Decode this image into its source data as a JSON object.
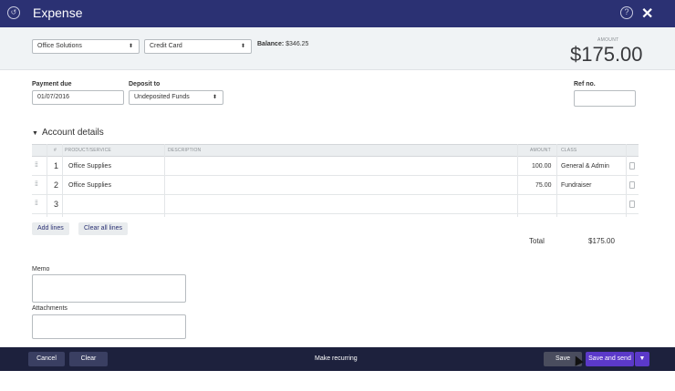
{
  "window": {
    "title": "Expense",
    "help_icon": "question-icon",
    "close_icon": "close-icon"
  },
  "header": {
    "payee": "Office Solutions",
    "account": "Credit Card",
    "balance_label": "Balance:",
    "balance_value": "$346.25",
    "amount_label": "AMOUNT",
    "amount_value": "$175.00"
  },
  "form": {
    "payment_due_label": "Payment due",
    "payment_due_value": "01/07/2016",
    "deposit_to_label": "Deposit to",
    "deposit_to_value": "Undeposited Funds",
    "ref_no_label": "Ref no.",
    "ref_no_value": ""
  },
  "account_details": {
    "title": "Account details",
    "columns": [
      "#",
      "PRODUCT/SERVICE",
      "DESCRIPTION",
      "AMOUNT",
      "CLASS"
    ],
    "rows": [
      {
        "num": "1",
        "product": "Office Supplies",
        "description": "",
        "amount": "100.00",
        "class": "General & Admin"
      },
      {
        "num": "2",
        "product": "Office Supplies",
        "description": "",
        "amount": "75.00",
        "class": "Fundraiser"
      },
      {
        "num": "3",
        "product": "",
        "description": "",
        "amount": "",
        "class": ""
      }
    ],
    "add_lines": "Add lines",
    "clear_all_lines": "Clear all lines",
    "total_label": "Total",
    "total_value": "$175.00"
  },
  "memo_label": "Memo",
  "attachments_label": "Attachments",
  "footer": {
    "cancel": "Cancel",
    "clear": "Clear",
    "make_recurring": "Make recurring",
    "save": "Save",
    "save_and_send": "Save and send"
  },
  "colors": {
    "titlebar": "#2b3173",
    "footer": "#1d213d",
    "primary": "#5b39c9"
  }
}
